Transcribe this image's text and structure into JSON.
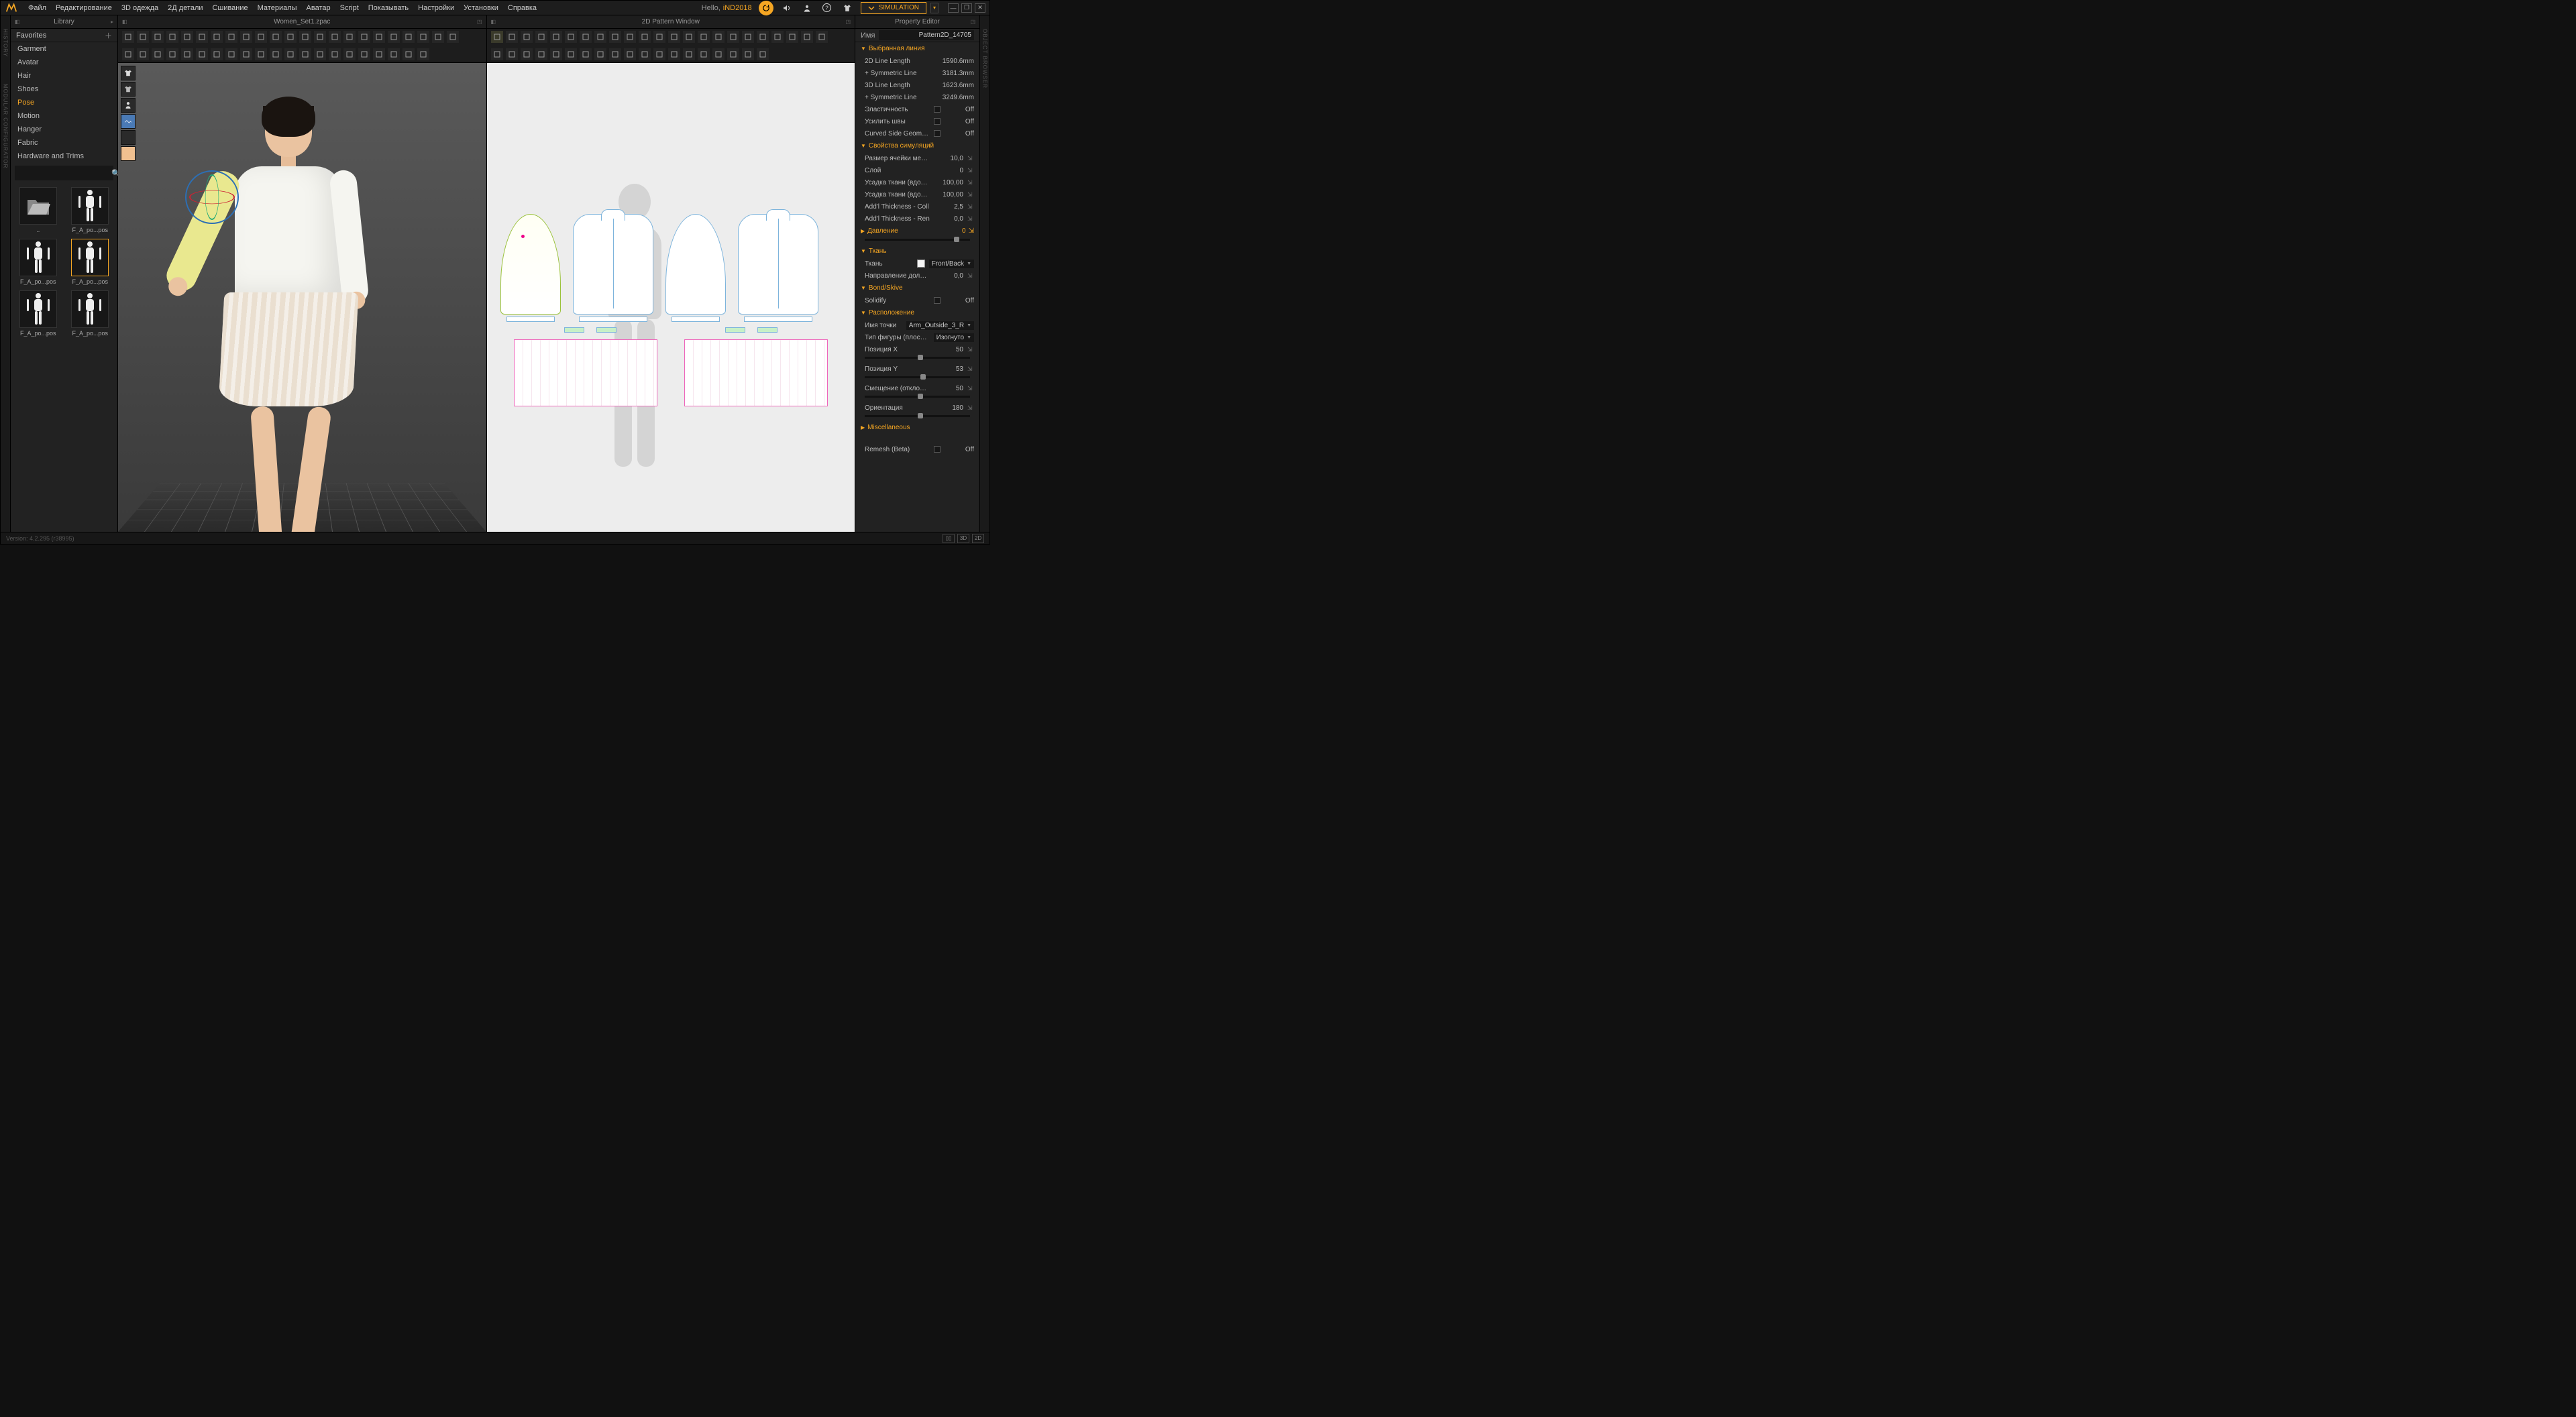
{
  "menubar": {
    "items": [
      "Файл",
      "Редактирование",
      "3D одежда",
      "2Д детали",
      "Сшивание",
      "Материалы",
      "Аватар",
      "Script",
      "Показывать",
      "Настройки",
      "Установки",
      "Справка"
    ],
    "hello": "Hello,",
    "user": "iND2018",
    "simulation": "SIMULATION"
  },
  "side_tabs_left": [
    "HISTORY",
    "MODULAR CONFIGURATOR"
  ],
  "side_tabs_right": [
    "OBJECT BROWSER"
  ],
  "library": {
    "title": "Library",
    "favorites": "Favorites",
    "items": [
      {
        "label": "Garment"
      },
      {
        "label": "Avatar"
      },
      {
        "label": "Hair"
      },
      {
        "label": "Shoes"
      },
      {
        "label": "Pose",
        "selected": true
      },
      {
        "label": "Motion"
      },
      {
        "label": "Hanger"
      },
      {
        "label": "Fabric"
      },
      {
        "label": "Hardware and Trims"
      }
    ],
    "search_placeholder": "",
    "thumbs": [
      {
        "label": "..",
        "type": "folder"
      },
      {
        "label": "F_A_po...pos",
        "selected": false
      },
      {
        "label": "F_A_po...pos"
      },
      {
        "label": "F_A_po...pos",
        "selected": true
      },
      {
        "label": "F_A_po...pos"
      },
      {
        "label": "F_A_po...pos"
      }
    ]
  },
  "view3d": {
    "title": "Women_Set1.zpac"
  },
  "view2d": {
    "title": "2D Pattern Window"
  },
  "property": {
    "title": "Property Editor",
    "name_label": "Имя",
    "name_value": "Pattern2D_14705",
    "sections": {
      "selected_line": {
        "title": "Выбранная линия",
        "rows": [
          {
            "lbl": "2D Line Length",
            "val": "1590.6mm"
          },
          {
            "lbl": "+ Symmetric Line",
            "val": "3181.3mm"
          },
          {
            "lbl": "3D Line Length",
            "val": "1623.6mm"
          },
          {
            "lbl": "+ Symmetric Line",
            "val": "3249.6mm"
          },
          {
            "lbl": "Эластичность",
            "val": "Off",
            "chk": true
          },
          {
            "lbl": "Усилить швы",
            "val": "Off",
            "chk": true
          },
          {
            "lbl": "Curved Side Geometry",
            "val": "Off",
            "chk": true
          }
        ]
      },
      "sim": {
        "title": "Свойства симуляций",
        "rows": [
          {
            "lbl": "Размер ячейки меши",
            "val": "10,0",
            "reset": true
          },
          {
            "lbl": "Слой",
            "val": "0",
            "reset": true
          },
          {
            "lbl": "Усадка ткани (вдоль)",
            "val": "100,00",
            "reset": true
          },
          {
            "lbl": "Усадка ткани (вдоль)",
            "val": "100,00",
            "reset": true
          },
          {
            "lbl": "Add'l Thickness - Coll",
            "val": "2,5",
            "reset": true
          },
          {
            "lbl": "Add'l Thickness - Ren",
            "val": "0,0",
            "reset": true
          }
        ]
      },
      "pressure": {
        "title": "Давление",
        "val": "0",
        "slider": 85
      },
      "fabric": {
        "title": "Ткань",
        "swatch_label": "Front/Back",
        "dir_lbl": "Направление долевой",
        "dir_val": "0,0"
      },
      "bond": {
        "title": "Bond/Skive",
        "rows": [
          {
            "lbl": "Solidify",
            "val": "Off",
            "chk": true
          }
        ]
      },
      "layout": {
        "title": "Расположение",
        "point_lbl": "Имя точки",
        "point_val": "Arm_Outside_3_R",
        "figtype_lbl": "Тип фигуры (плоская)",
        "figtype_val": "Изогнуто",
        "posx_lbl": "Позиция X",
        "posx_val": "50",
        "posy_lbl": "Позиция Y",
        "posy_val": "53",
        "offset_lbl": "Смещение (отклонен",
        "offset_val": "50",
        "orient_lbl": "Ориентация",
        "orient_val": "180"
      },
      "misc": {
        "title": "Miscellaneous"
      },
      "remesh": {
        "lbl": "Remesh (Beta)",
        "val": "Off"
      }
    }
  },
  "footer": {
    "version": "Version: 4.2.295 (r38995)",
    "btn3d": "3D",
    "btn2d": "2D"
  },
  "icons": {
    "toolbar3d_count": 44,
    "toolbar2d_count": 42
  }
}
